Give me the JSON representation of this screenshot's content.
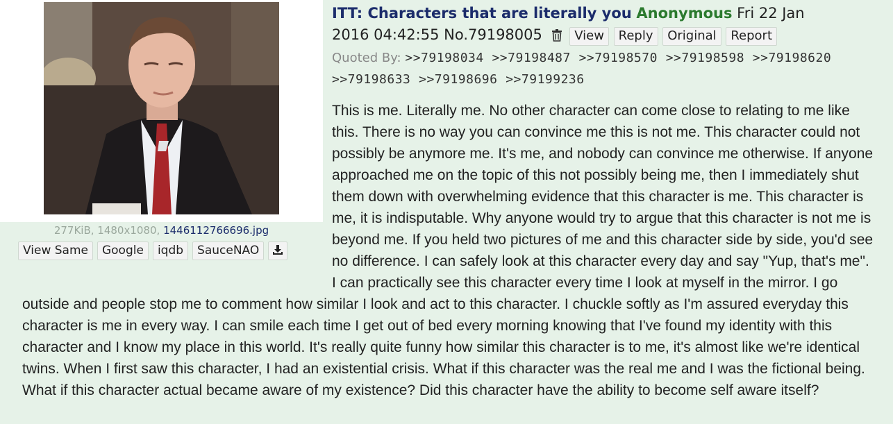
{
  "post": {
    "subject": "ITT: Characters that are literally you",
    "name": "Anonymous",
    "date_line1": "Fri 22 Jan",
    "date_line2": "2016 04:42:55",
    "number": "No.79198005",
    "buttons": {
      "view": "View",
      "reply": "Reply",
      "original": "Original",
      "report": "Report"
    },
    "quoted_by_label": "Quoted By:",
    "quoted_by": [
      ">>79198034",
      ">>79198487",
      ">>79198570",
      ">>79198598",
      ">>79198620",
      ">>79198633",
      ">>79198696",
      ">>79199236"
    ],
    "comment": "This is me. Literally me. No other character can come close to relating to me like this. There is no way you can convince me this is not me. This character could not possibly be anymore me. It's me, and nobody can convince me otherwise. If anyone approached me on the topic of this not possibly being me, then I immediately shut them down with overwhelming evidence that this character is me. This character is me, it is indisputable. Why anyone would try to argue that this character is not me is beyond me. If you held two pictures of me and this character side by side, you'd see no difference. I can safely look at this character every day and say \"Yup, that's me\". I can practically see this character every time I look at myself in the mirror. I go outside and people stop me to comment how similar I look and act to this character. I chuckle softly as I'm assured everyday this character is me in every way. I can smile each time I get out of bed every morning knowing that I've found my identity with this character and I know my place in this world. It's really quite funny how similar this character is to me, it's almost like we're identical twins. When I first saw this character, I had an existential crisis. What if this character was the real me and I was the fictional being. What if this character actual became aware of my existence? Did this character have the ability to become self aware itself?"
  },
  "file": {
    "meta": "277KiB, 1480x1080,",
    "filename": "1446112766696.jpg"
  },
  "image_search": {
    "view_same": "View Same",
    "google": "Google",
    "iqdb": "iqdb",
    "saucenao": "SauceNAO"
  },
  "icons": {
    "trash": "trash-icon",
    "download": "download-icon"
  },
  "colors": {
    "post_bg": "#e6f2e8",
    "subject": "#1b2c6b",
    "name": "#2b7a2e"
  }
}
